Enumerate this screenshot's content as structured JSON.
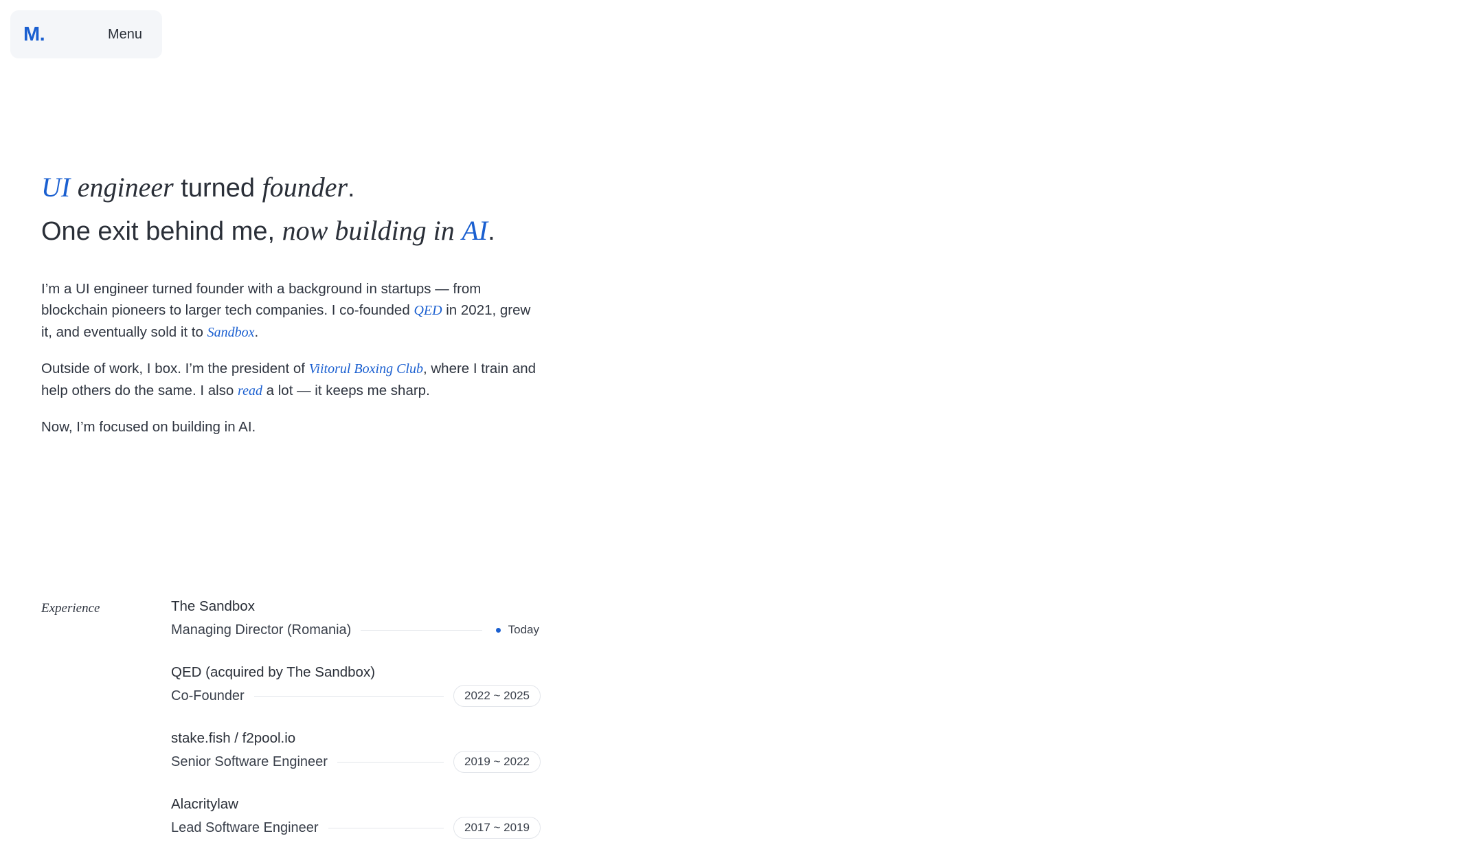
{
  "nav": {
    "logo": "M.",
    "menu_label": "Menu"
  },
  "hero": {
    "line1": {
      "ui": "UI",
      "engineer": "engineer",
      "turned": " turned ",
      "founder": "founder",
      "period": "."
    },
    "line2": {
      "exit": "One exit behind me, ",
      "building": "now building in",
      "space": " ",
      "ai": "AI",
      "period": "."
    }
  },
  "bio": {
    "p1": {
      "before": "I’m a UI engineer turned founder with a background in startups — from blockchain pioneers to larger tech companies. I co-founded ",
      "link1": "QED",
      "middle": " in 2021, grew it, and eventually sold it to ",
      "link2": "Sandbox",
      "after": "."
    },
    "p2": {
      "before": "Outside of work, I box. I’m the president of ",
      "link1": "Viitorul Boxing Club",
      "middle": ", where I train and help others do the same. I also ",
      "link2": "read",
      "after": " a lot — it keeps me sharp."
    },
    "p3": "Now, I’m focused on building in AI."
  },
  "experience": {
    "label": "Experience",
    "jobs": [
      {
        "company": "The Sandbox",
        "role": "Managing Director (Romania)",
        "period": "Today",
        "current": true
      },
      {
        "company": "QED (acquired by The Sandbox)",
        "role": "Co-Founder",
        "period": "2022 ~ 2025",
        "current": false
      },
      {
        "company": "stake.fish / f2pool.io",
        "role": "Senior Software Engineer",
        "period": "2019 ~ 2022",
        "current": false
      },
      {
        "company": "Alacritylaw",
        "role": "Lead Software Engineer",
        "period": "2017 ~ 2019",
        "current": false
      }
    ]
  },
  "colors": {
    "accent": "#1a5fd0",
    "text": "#2a2f38",
    "nav_bg": "#f4f6f9",
    "rule": "#e2e5ea"
  }
}
